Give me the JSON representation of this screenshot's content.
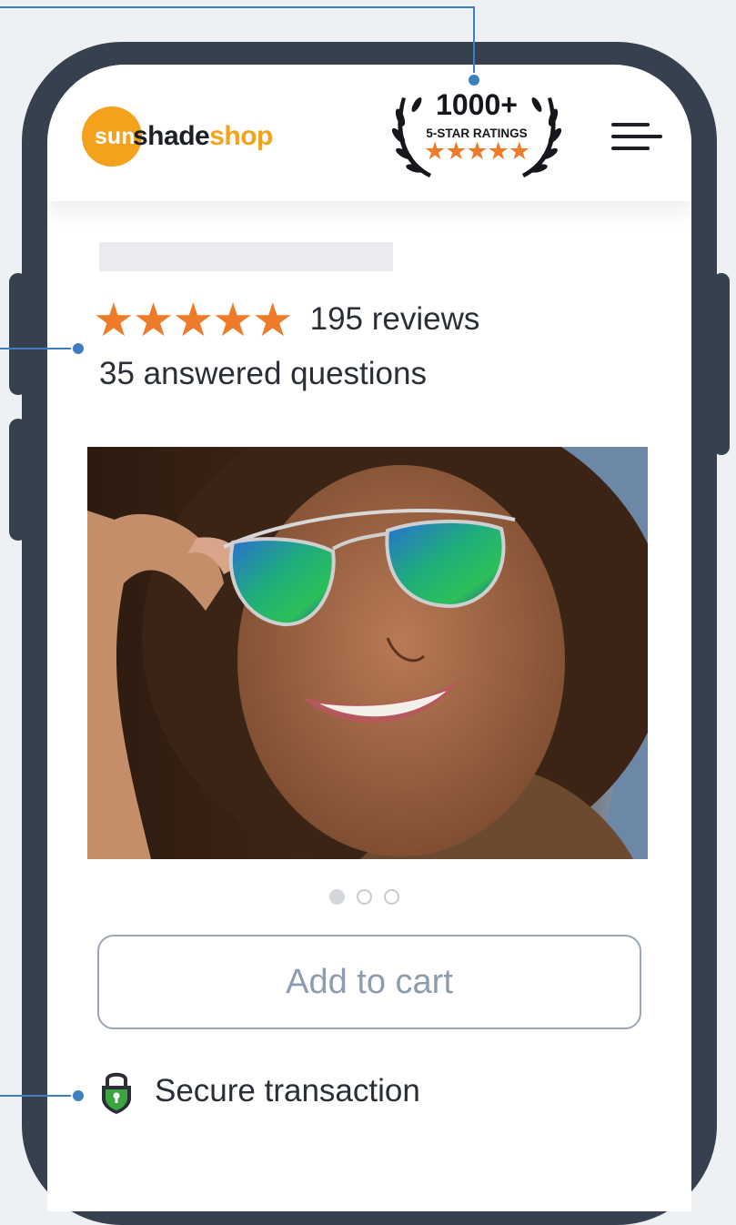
{
  "header": {
    "logo": {
      "part1": "sun",
      "part2": "shade",
      "part3": "shop"
    },
    "badge": {
      "count": "1000+",
      "label": "5-STAR RATINGS",
      "stars": "★★★★★"
    },
    "menu_icon": "hamburger-menu-icon"
  },
  "product": {
    "rating": {
      "stars": "★★★★★",
      "reviews": "195 reviews",
      "value": 5,
      "max": 5
    },
    "questions": "35 answered questions",
    "image": {
      "description_icon": "product-photo"
    },
    "carousel": {
      "total": 3,
      "active": 1
    }
  },
  "actions": {
    "add_to_cart": "Add to cart"
  },
  "trust": {
    "secure": "Secure transaction",
    "icon": "padlock-shield-icon"
  },
  "colors": {
    "accent_star": "#ee7b2a",
    "logo_orange": "#f4a21c",
    "phone_frame": "#36404f",
    "callout_line": "#3f7fbf",
    "lock_green": "#3aa43f"
  }
}
